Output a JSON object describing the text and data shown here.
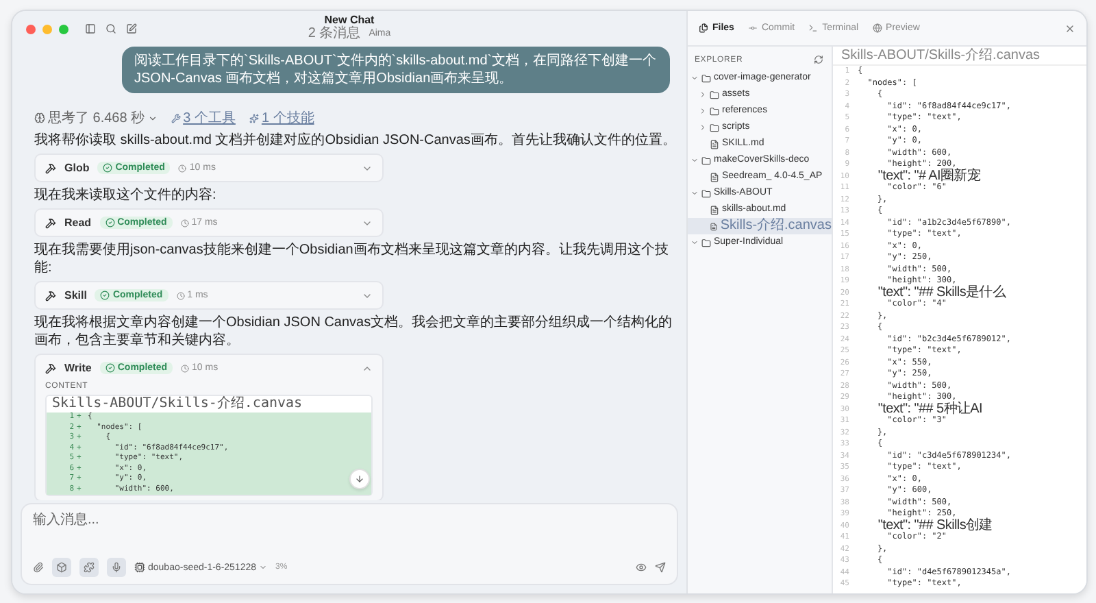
{
  "window": {
    "title": "New Chat",
    "message_count": "2 条消息",
    "agent": "Aima"
  },
  "user_message": "阅读工作目录下的`Skills-ABOUT`文件内的`skills-about.md`文档，在同路径下创建一个 JSON-Canvas 画布文档，对这篇文章用Obsidian画布来呈现。",
  "activity": {
    "thinking": "思考了 6.468 秒",
    "tools": "3 个工具",
    "skills": "1 个技能"
  },
  "transcript": [
    {
      "kind": "text",
      "text": "我将帮你读取 skills-about.md 文档并创建对应的Obsidian JSON-Canvas画布。首先让我确认文件的位置。"
    },
    {
      "kind": "tool",
      "name": "Glob",
      "status": "Completed",
      "duration": "10 ms",
      "expanded": false
    },
    {
      "kind": "text",
      "text": "现在我来读取这个文件的内容:"
    },
    {
      "kind": "tool",
      "name": "Read",
      "status": "Completed",
      "duration": "17 ms",
      "expanded": false
    },
    {
      "kind": "text",
      "text": "现在我需要使用json-canvas技能来创建一个Obsidian画布文档来呈现这篇文章的内容。让我先调用这个技能:"
    },
    {
      "kind": "tool",
      "name": "Skill",
      "status": "Completed",
      "duration": "1 ms",
      "expanded": false
    },
    {
      "kind": "text",
      "text": "现在我将根据文章内容创建一个Obsidian JSON Canvas文档。我会把文章的主要部分组织成一个结构化的画布，包含主要章节和关键内容。"
    },
    {
      "kind": "tool",
      "name": "Write",
      "status": "Completed",
      "duration": "10 ms",
      "expanded": true,
      "content_label": "CONTENT",
      "file": "Skills-ABOUT/Skills-介绍.canvas",
      "lines": [
        {
          "number": "1",
          "marker": "+",
          "code": "{"
        },
        {
          "number": "2",
          "marker": "+",
          "code": "  \"nodes\": ["
        },
        {
          "number": "3",
          "marker": "+",
          "code": "    {"
        },
        {
          "number": "4",
          "marker": "+",
          "code": "      \"id\": \"6f8ad84f44ce9c17\","
        },
        {
          "number": "5",
          "marker": "+",
          "code": "      \"type\": \"text\","
        },
        {
          "number": "6",
          "marker": "+",
          "code": "      \"x\": 0,"
        },
        {
          "number": "7",
          "marker": "+",
          "code": "      \"y\": 0,"
        },
        {
          "number": "8",
          "marker": "+",
          "code": "      \"width\": 600,"
        }
      ]
    }
  ],
  "composer": {
    "placeholder": "输入消息...",
    "model": "doubao-seed-1-6-251228",
    "context": "3%"
  },
  "panel": {
    "tabs": [
      {
        "label": "Files",
        "selected": true
      },
      {
        "label": "Commit",
        "selected": false
      },
      {
        "label": "Terminal",
        "selected": false
      },
      {
        "label": "Preview",
        "selected": false
      }
    ],
    "explorer": {
      "title": "EXPLORER",
      "tree": [
        {
          "name": "cover-image-generator",
          "kind": "folder",
          "expanded": true,
          "selected": false,
          "children": [
            {
              "name": "assets",
              "kind": "folder",
              "expanded": false,
              "selected": false
            },
            {
              "name": "references",
              "kind": "folder",
              "expanded": false,
              "selected": false
            },
            {
              "name": "scripts",
              "kind": "folder",
              "expanded": false,
              "selected": false
            },
            {
              "name": "SKILL.md",
              "kind": "file",
              "selected": false
            }
          ]
        },
        {
          "name": "makeCoverSkills-deco",
          "kind": "folder",
          "expanded": true,
          "selected": false,
          "children": [
            {
              "name": "Seedream_ 4.0-4.5_AP",
              "kind": "file",
              "selected": false
            }
          ]
        },
        {
          "name": "Skills-ABOUT",
          "kind": "folder",
          "expanded": true,
          "selected": false,
          "children": [
            {
              "name": "skills-about.md",
              "kind": "file",
              "selected": false
            },
            {
              "name": "Skills-介绍.canvas",
              "kind": "file",
              "selected": true
            }
          ]
        },
        {
          "name": "Super-Individual",
          "kind": "folder",
          "expanded": true,
          "selected": false
        }
      ]
    },
    "editor": {
      "path": "Skills-ABOUT/Skills-介绍.canvas",
      "lines": [
        {
          "number": "1",
          "code": "{"
        },
        {
          "number": "2",
          "code": "  \"nodes\": ["
        },
        {
          "number": "3",
          "code": "    {"
        },
        {
          "number": "4",
          "code": "      \"id\": \"6f8ad84f44ce9c17\","
        },
        {
          "number": "5",
          "code": "      \"type\": \"text\","
        },
        {
          "number": "6",
          "code": "      \"x\": 0,"
        },
        {
          "number": "7",
          "code": "      \"y\": 0,"
        },
        {
          "number": "8",
          "code": "      \"width\": 600,"
        },
        {
          "number": "9",
          "code": "      \"height\": 200,"
        },
        {
          "number": "10",
          "code": "      \"text\": \"# AI圈新宠"
        },
        {
          "number": "11",
          "code": "      \"color\": \"6\""
        },
        {
          "number": "12",
          "code": "    },"
        },
        {
          "number": "13",
          "code": "    {"
        },
        {
          "number": "14",
          "code": "      \"id\": \"a1b2c3d4e5f67890\","
        },
        {
          "number": "15",
          "code": "      \"type\": \"text\","
        },
        {
          "number": "16",
          "code": "      \"x\": 0,"
        },
        {
          "number": "17",
          "code": "      \"y\": 250,"
        },
        {
          "number": "18",
          "code": "      \"width\": 500,"
        },
        {
          "number": "19",
          "code": "      \"height\": 300,"
        },
        {
          "number": "20",
          "code": "      \"text\": \"## Skills是什么"
        },
        {
          "number": "21",
          "code": "      \"color\": \"4\""
        },
        {
          "number": "22",
          "code": "    },"
        },
        {
          "number": "23",
          "code": "    {"
        },
        {
          "number": "24",
          "code": "      \"id\": \"b2c3d4e5f6789012\","
        },
        {
          "number": "25",
          "code": "      \"type\": \"text\","
        },
        {
          "number": "26",
          "code": "      \"x\": 550,"
        },
        {
          "number": "27",
          "code": "      \"y\": 250,"
        },
        {
          "number": "28",
          "code": "      \"width\": 500,"
        },
        {
          "number": "29",
          "code": "      \"height\": 300,"
        },
        {
          "number": "30",
          "code": "      \"text\": \"## 5种让AI"
        },
        {
          "number": "31",
          "code": "      \"color\": \"3\""
        },
        {
          "number": "32",
          "code": "    },"
        },
        {
          "number": "33",
          "code": "    {"
        },
        {
          "number": "34",
          "code": "      \"id\": \"c3d4e5f678901234\","
        },
        {
          "number": "35",
          "code": "      \"type\": \"text\","
        },
        {
          "number": "36",
          "code": "      \"x\": 0,"
        },
        {
          "number": "37",
          "code": "      \"y\": 600,"
        },
        {
          "number": "38",
          "code": "      \"width\": 500,"
        },
        {
          "number": "39",
          "code": "      \"height\": 250,"
        },
        {
          "number": "40",
          "code": "      \"text\": \"## Skills创建"
        },
        {
          "number": "41",
          "code": "      \"color\": \"2\""
        },
        {
          "number": "42",
          "code": "    },"
        },
        {
          "number": "43",
          "code": "    {"
        },
        {
          "number": "44",
          "code": "      \"id\": \"d4e5f6789012345a\","
        },
        {
          "number": "45",
          "code": "      \"type\": \"text\","
        }
      ]
    }
  }
}
